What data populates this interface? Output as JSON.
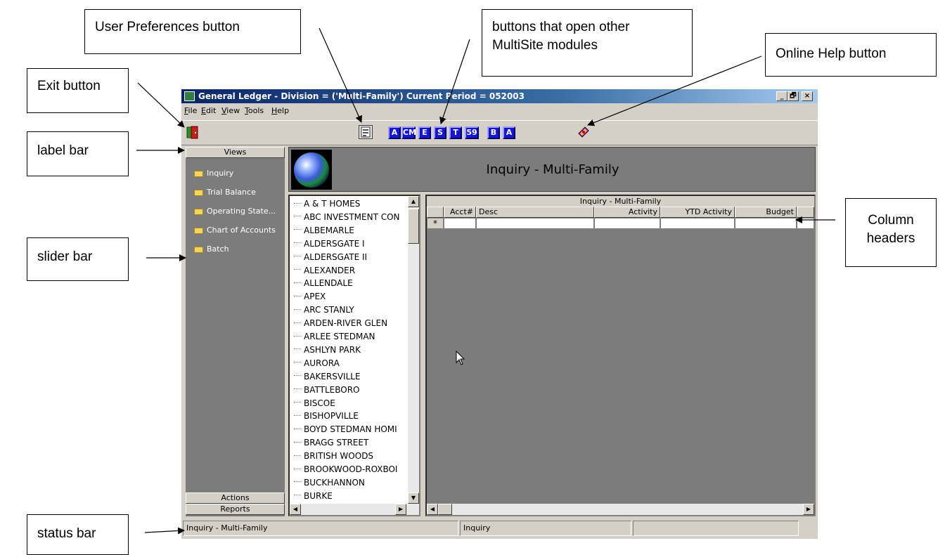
{
  "callouts": {
    "user_prefs": "User Preferences button",
    "modules": "buttons that open other MultiSite modules",
    "online_help": "Online Help button",
    "exit": "Exit button",
    "label_bar": "label bar",
    "slider_bar": "slider bar",
    "column_headers": "Column headers",
    "status_bar": "status bar"
  },
  "window": {
    "title": "General Ledger - Division = ('Multi-Family') Current Period = 052003",
    "controls": [
      "_",
      "🗗",
      "×"
    ]
  },
  "menu": [
    {
      "label": "File",
      "accel": "F",
      "rest": "ile"
    },
    {
      "label": "Edit",
      "accel": "E",
      "rest": "dit"
    },
    {
      "label": "View",
      "accel": "V",
      "rest": "iew"
    },
    {
      "label": "Tools",
      "accel": "T",
      "rest": "ools"
    },
    {
      "label": "Help",
      "accel": "H",
      "rest": "elp"
    }
  ],
  "toolbar": {
    "exit_icon": "exit-door-icon",
    "prefs_icon": "user-preferences-icon",
    "help_icon": "online-help-book-icon",
    "modules": [
      "A",
      "CM",
      "E",
      "S",
      "T",
      "59",
      "B",
      "A"
    ]
  },
  "left_pane": {
    "header": "Views",
    "items": [
      "Inquiry",
      "Trial Balance",
      "Operating State...",
      "Chart of Accounts",
      "Batch"
    ],
    "actions": "Actions",
    "reports": "Reports"
  },
  "banner": {
    "title": "Inquiry - Multi-Family",
    "logo_icon": "globe-logo-icon"
  },
  "list": [
    "A & T HOMES",
    "ABC INVESTMENT CON",
    "ALBEMARLE",
    "ALDERSGATE I",
    "ALDERSGATE II",
    "ALEXANDER",
    "ALLENDALE",
    "APEX",
    "ARC STANLY",
    "ARDEN-RIVER GLEN",
    "ARLEE STEDMAN",
    "ASHLYN PARK",
    "AURORA",
    "BAKERSVILLE",
    "BATTLEBORO",
    "BISCOE",
    "BISHOPVILLE",
    "BOYD STEDMAN HOMI",
    "BRAGG STREET",
    "BRITISH WOODS",
    "BROOKWOOD-ROXBOI",
    "BUCKHANNON",
    "BURKE"
  ],
  "grid": {
    "caption": "Inquiry - Multi-Family",
    "columns": [
      "Acct#",
      "Desc",
      "Activity",
      "YTD Activity",
      "Budget"
    ],
    "new_row_marker": "*"
  },
  "status": {
    "left": "Inquiry - Multi-Family",
    "middle": "Inquiry",
    "right": ""
  }
}
